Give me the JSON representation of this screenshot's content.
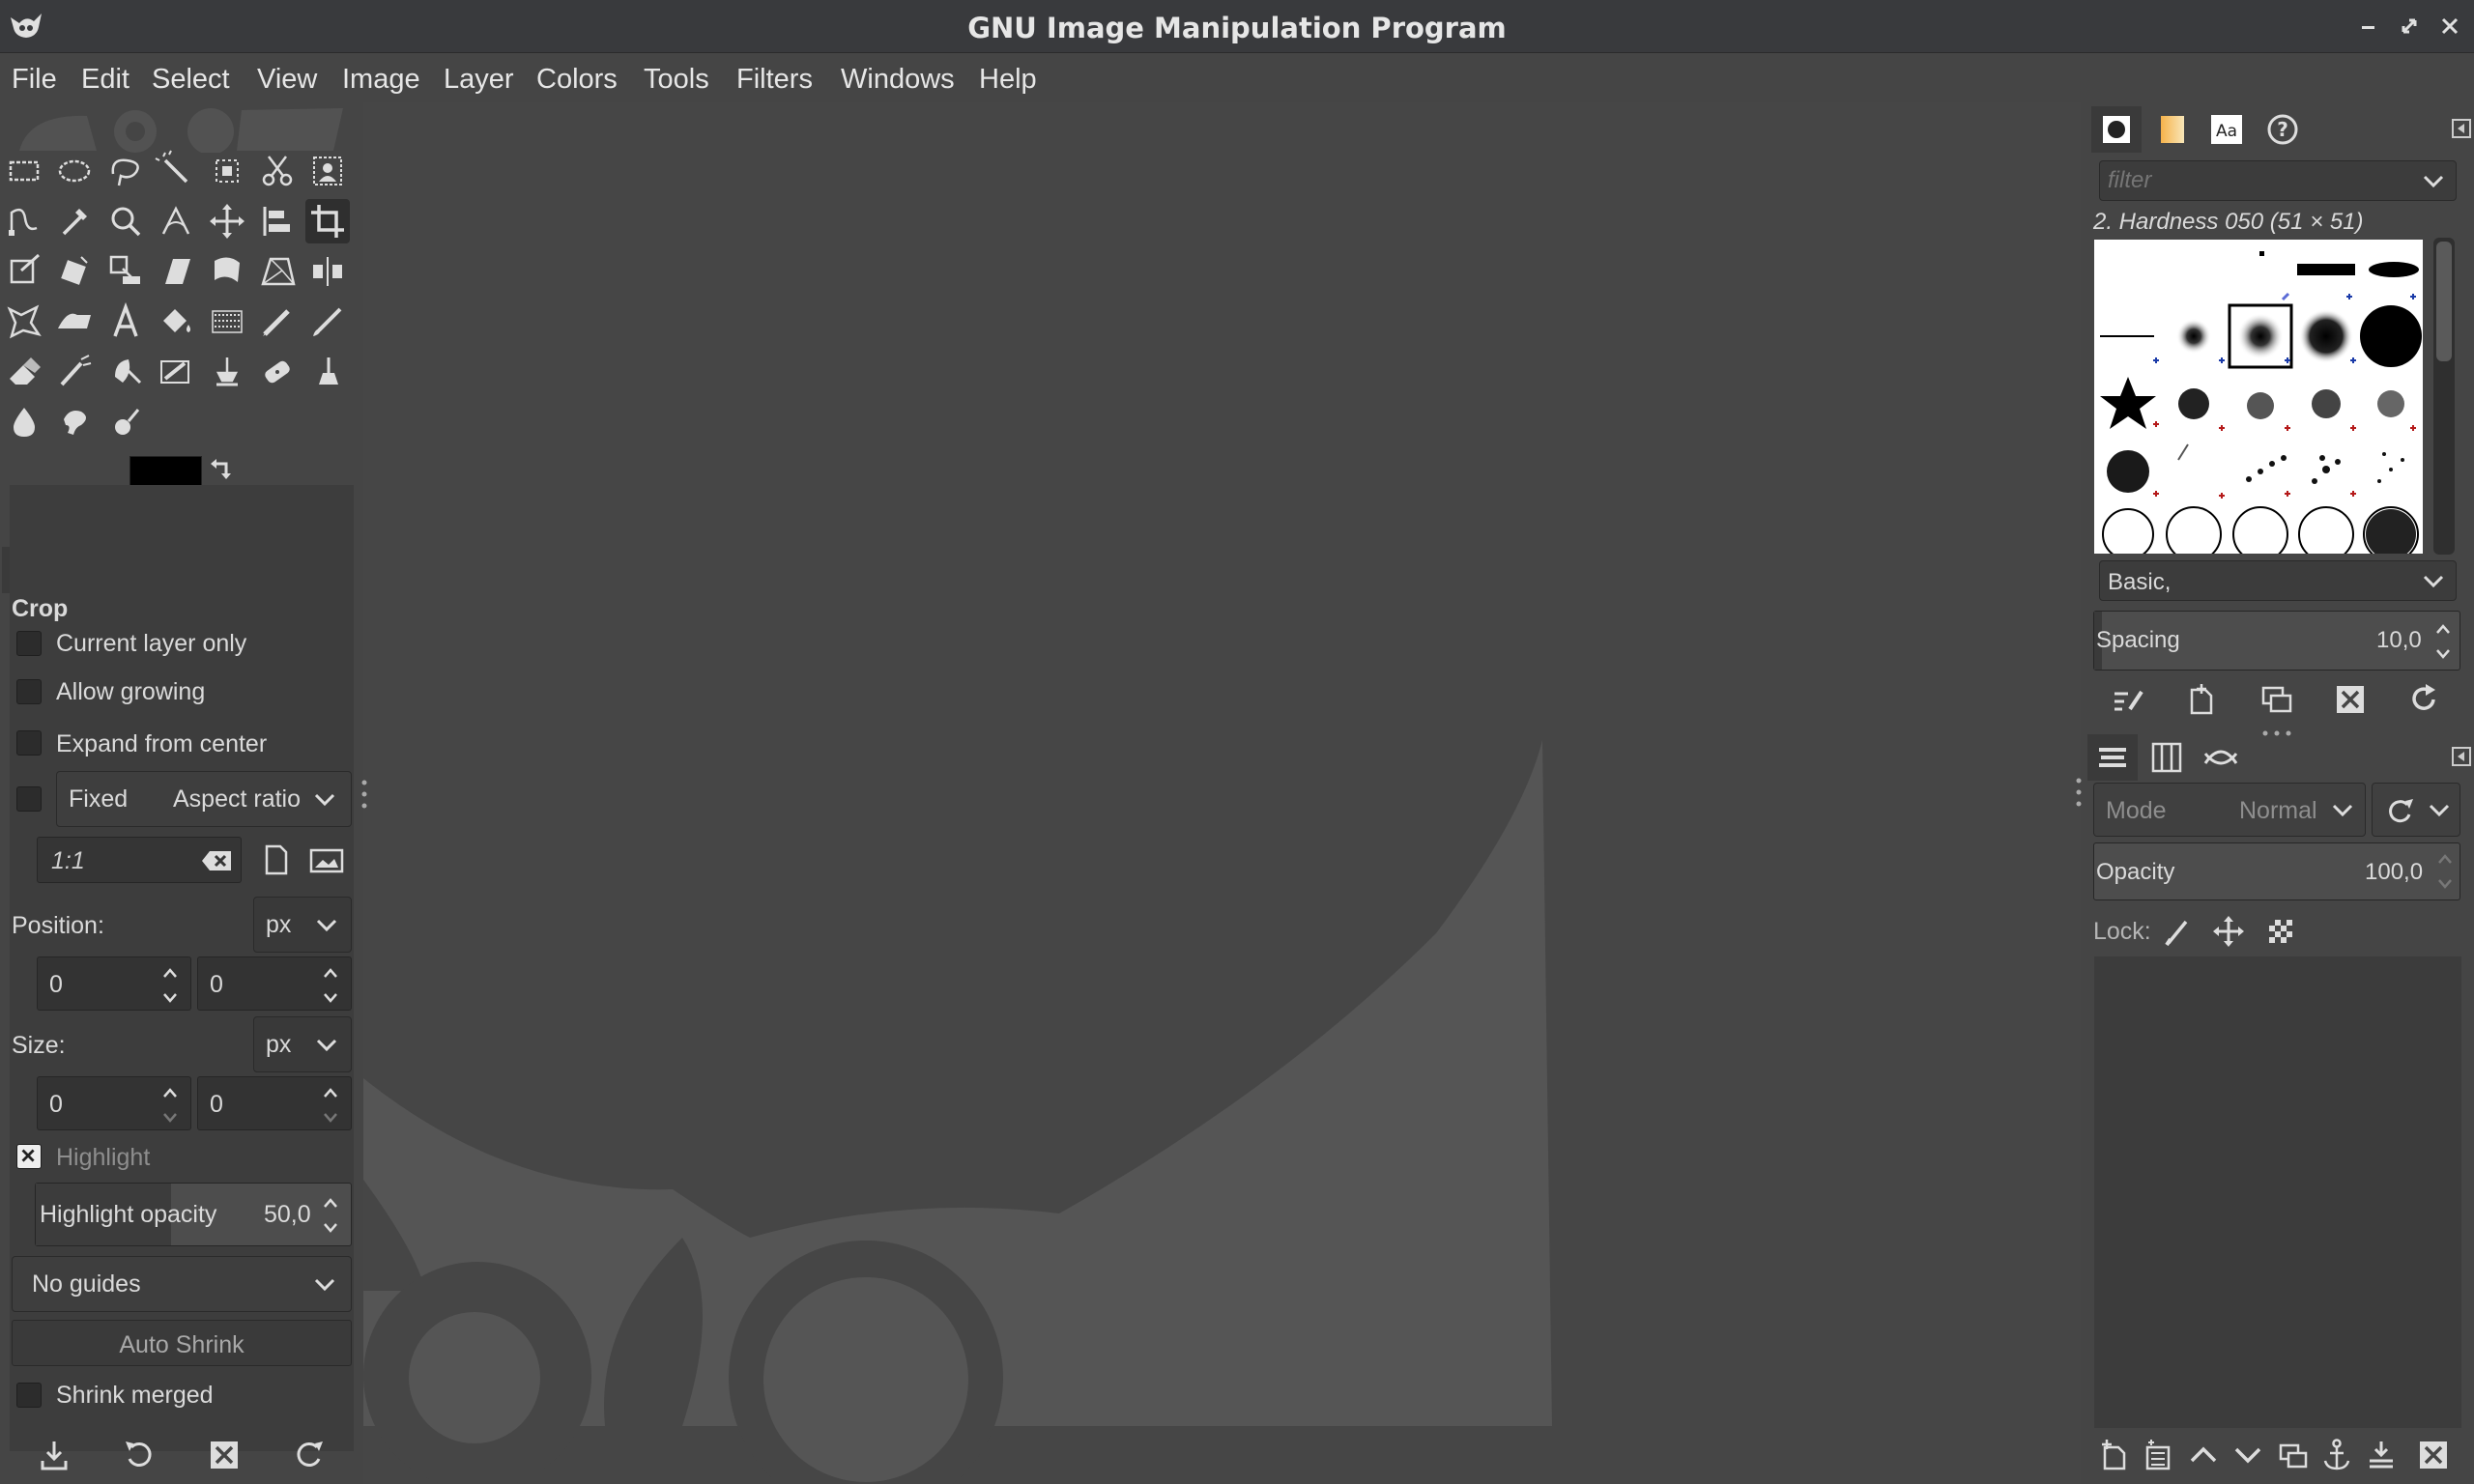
{
  "window": {
    "title": "GNU Image Manipulation Program",
    "controls": [
      "minimize-icon",
      "restore-icon",
      "close-icon"
    ]
  },
  "menubar": {
    "items": [
      "File",
      "Edit",
      "Select",
      "View",
      "Image",
      "Layer",
      "Colors",
      "Tools",
      "Filters",
      "Windows",
      "Help"
    ]
  },
  "toolbox": {
    "tools": [
      "rect-select-icon",
      "ellipse-select-icon",
      "free-select-icon",
      "fuzzy-select-icon",
      "select-by-color-icon",
      "scissors-select-icon",
      "foreground-select-icon",
      "paths-icon",
      "color-picker-icon",
      "zoom-icon",
      "measure-icon",
      "move-icon",
      "align-icon",
      "crop-icon",
      "unified-transform-icon",
      "rotate-icon",
      "scale-icon",
      "shear-icon",
      "warp-icon",
      "perspective-icon",
      "flip-icon",
      "cage-transform-icon",
      "smudge-wave-icon",
      "text-icon",
      "bucket-fill-icon",
      "gradient-icon",
      "pencil-icon",
      "paintbrush-icon",
      "eraser-icon",
      "airbrush-icon",
      "ink-icon",
      "mypaint-brush-icon",
      "clone-icon",
      "heal-icon",
      "perspective-clone-icon",
      "blur-icon",
      "smudge-icon",
      "dodge-burn-icon"
    ],
    "active_tool": "crop-icon",
    "foreground_color": "#000000",
    "background_color": "#ffffff"
  },
  "tool_options": {
    "tabs": [
      "tool-options-icon",
      "device-status-icon",
      "undo-history-icon",
      "images-icon"
    ],
    "title": "Crop",
    "current_layer_only": "Current layer only",
    "allow_growing": "Allow growing",
    "expand_from_center": "Expand from center",
    "fixed_label": "Fixed",
    "fixed_mode": "Aspect ratio",
    "ratio_value": "1:1",
    "position_label": "Position:",
    "position_unit": "px",
    "position_x": "0",
    "position_y": "0",
    "size_label": "Size:",
    "size_unit": "px",
    "size_w": "0",
    "size_h": "0",
    "highlight_label": "Highlight",
    "highlight_opacity_label": "Highlight opacity",
    "highlight_opacity_value": "50,0",
    "guides": "No guides",
    "auto_shrink": "Auto Shrink",
    "shrink_merged": "Shrink merged",
    "footer_icons": [
      "save-preset-icon",
      "restore-preset-icon",
      "delete-preset-icon",
      "reset-icon"
    ]
  },
  "brushes_panel": {
    "tabs": [
      "brushes-icon",
      "gradients-icon",
      "fonts-icon",
      "help-icon"
    ],
    "filter_placeholder": "filter",
    "selected_brush": "2. Hardness 050 (51 × 51)",
    "preset": "Basic,",
    "spacing_label": "Spacing",
    "spacing_value": "10,0",
    "footer_icons": [
      "edit-brush-icon",
      "new-brush-icon",
      "duplicate-brush-icon",
      "delete-brush-icon",
      "refresh-brushes-icon"
    ]
  },
  "layers_panel": {
    "tabs": [
      "layers-icon",
      "channels-icon",
      "paths-icon"
    ],
    "mode_label": "Mode",
    "mode_value": "Normal",
    "opacity_label": "Opacity",
    "opacity_value": "100,0",
    "lock_label": "Lock:",
    "footer_icons": [
      "new-layer-icon",
      "new-layer-group-icon",
      "raise-layer-icon",
      "lower-layer-icon",
      "duplicate-layer-icon",
      "anchor-layer-icon",
      "merge-layer-icon",
      "delete-layer-icon"
    ]
  }
}
